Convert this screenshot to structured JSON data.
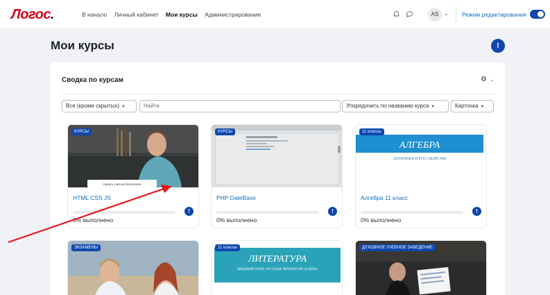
{
  "brand": {
    "logo_text": "Логос",
    "logo_dot": "."
  },
  "nav": [
    {
      "label": "В начало",
      "active": false
    },
    {
      "label": "Личный кабинет",
      "active": false
    },
    {
      "label": "Мои курсы",
      "active": true
    },
    {
      "label": "Администрирование",
      "active": false
    }
  ],
  "user": {
    "initials": "AS"
  },
  "edit_mode": {
    "label": "Режим редактирования",
    "enabled": true
  },
  "page": {
    "title": "Мои курсы"
  },
  "panel": {
    "title": "Сводка по курсам"
  },
  "filters": {
    "grouping": "Все (кроме скрытых)",
    "search_placeholder": "Найти",
    "sort": "Упорядочить по названию курса",
    "view": "Карточка"
  },
  "courses": [
    {
      "category": "КУРСЫ",
      "name": "HTML CSS JS",
      "progress_label": "0% выполнено",
      "progress": 0,
      "image_caption": "Начать учиться бесплатно"
    },
    {
      "category": "КУРСЫ",
      "name": "PHP DateBase",
      "progress_label": "0% выполнено",
      "progress": 0
    },
    {
      "category": "11 классы",
      "name": "Алгебра 11 класс",
      "progress_label": "0% выполнено",
      "progress": 0,
      "image_title": "АЛГЕБРА",
      "image_subtitle": "ЛОГАРИФМ И ЕГО СВОЙСТВА"
    },
    {
      "category": "ЭКЗАМЕНЫ"
    },
    {
      "category": "11 классы",
      "image_title": "ЛИТЕРАТУРА",
      "image_subtitle": "ВВОДНЫЙ УРОК. РУССКАЯ ЛИТЕРАТУРА 20 ВЕКА."
    },
    {
      "category": "ДУХОВНОЕ УЧЕБНОЕ ЗАВЕДЕНИЕ"
    }
  ],
  "colors": {
    "accent": "#0f47ad",
    "link": "#0f6cbf",
    "logo": "#d0021b",
    "annotation_arrow": "#e8141c"
  }
}
